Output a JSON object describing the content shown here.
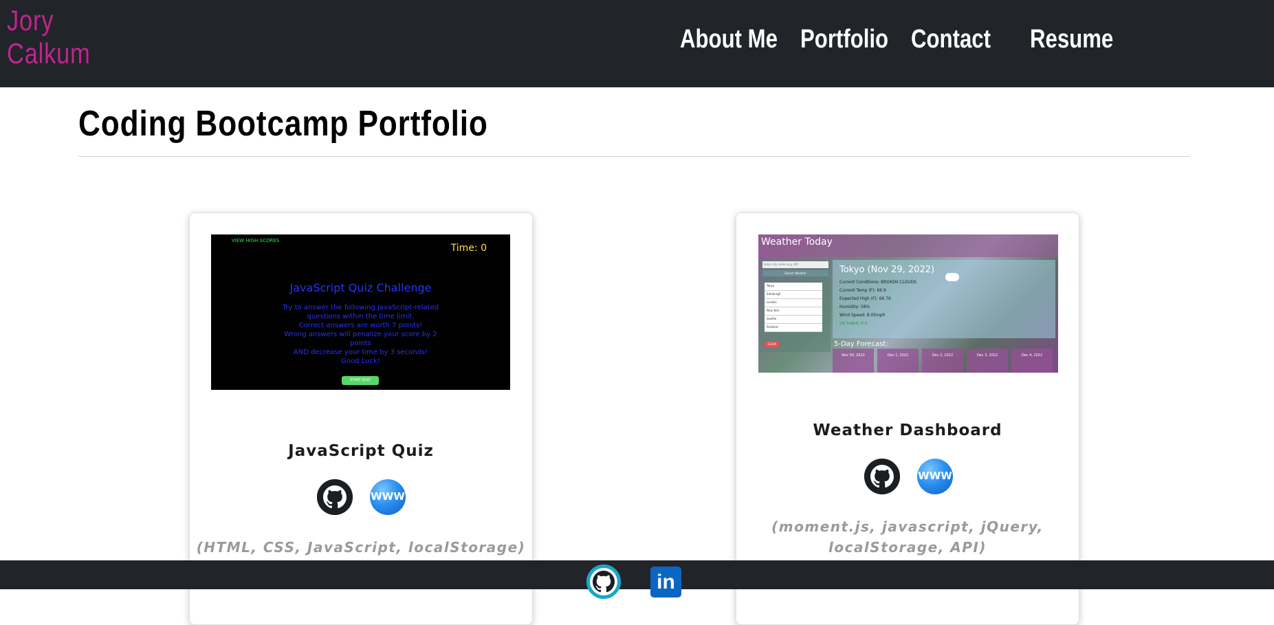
{
  "header": {
    "brand_first": "Jory",
    "brand_last": "Calkum",
    "nav": [
      "About Me",
      "Portfolio",
      "Contact",
      "Resume"
    ]
  },
  "page_title": "Coding Bootcamp Portfolio",
  "cards": [
    {
      "title": "JavaScript Quiz",
      "tech": "(HTML, CSS, JavaScript, localStorage)",
      "github_icon": "github-icon",
      "www_label": "WWW",
      "screenshot": {
        "high_scores": "VIEW HIGH SCORES",
        "time": "Time: 0",
        "heading": "JavaScript Quiz Challenge",
        "body_lines": [
          "Try to answer the following JavaScript-related",
          "questions within the time limit.",
          "Correct answers are worth 7 points!",
          "Wrong answers will penalize your score by 2",
          "points",
          "AND decrease your time by 3 seconds!",
          "Good Luck!"
        ],
        "start_button": "START QUIZ"
      }
    },
    {
      "title": "Weather Dashboard",
      "tech_line1": "(moment.js, javascript, jQuery,",
      "tech_line2": "localStorage, API)",
      "github_icon": "github-icon",
      "www_label": "WWW",
      "screenshot": {
        "header": "Weather Today",
        "search_placeholder": "Enter city name (e.g. NY)",
        "search_button": "Search Weather",
        "cities": [
          "Tokyo",
          "Edinburgh",
          "London",
          "New York",
          "Seattle",
          "Portland"
        ],
        "clear_button": "CLEAR",
        "city": "Tokyo (Nov 29, 2022)",
        "details": [
          "Current Conditions: BROKEN CLOUDS",
          "Current Temp (F): 66.9",
          "Expected High (F): 66.76",
          "Humidity: 58%",
          "Wind Speed: 8.05mph"
        ],
        "uv": "UV Index: 0.5",
        "forecast_label": "5-Day Forecast:",
        "forecast_days": [
          "Nov 30, 2022",
          "Dec 1, 2022",
          "Dec 2, 2022",
          "Dec 3, 2022",
          "Dec 4, 2022"
        ]
      }
    }
  ],
  "footer": {
    "github_icon": "github-icon",
    "linkedin_label": "in"
  },
  "colors": {
    "header_bg": "#212429",
    "brand": "#c4238f",
    "footer_github": "#1aa6c9",
    "linkedin": "#0a66c2"
  }
}
